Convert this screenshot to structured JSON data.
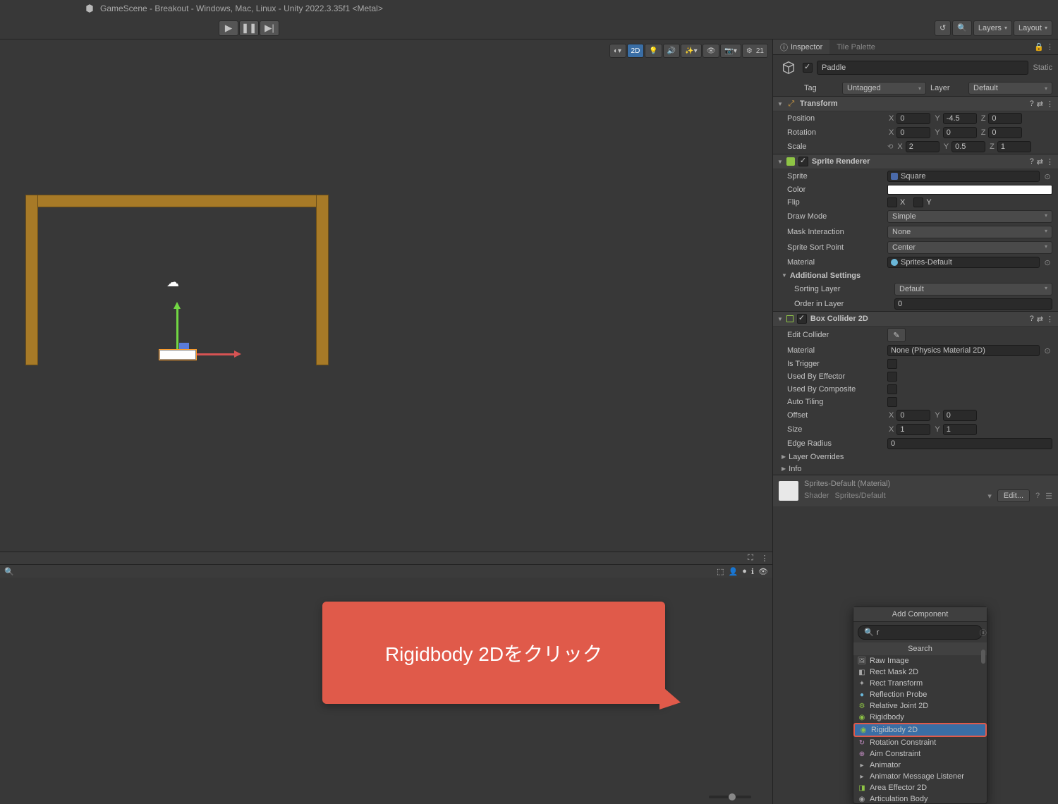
{
  "titlebar": {
    "text": "GameScene - Breakout - Windows, Mac, Linux - Unity 2022.3.35f1 <Metal>"
  },
  "toolbar": {
    "layers_label": "Layers",
    "layout_label": "Layout",
    "scene2d_label": "2D",
    "scene_count": "21"
  },
  "inspector": {
    "tab_inspector": "Inspector",
    "tab_tilepalette": "Tile Palette",
    "object_name": "Paddle",
    "static_label": "Static",
    "tag_label": "Tag",
    "tag_value": "Untagged",
    "layer_label": "Layer",
    "layer_value": "Default",
    "transform": {
      "title": "Transform",
      "position_label": "Position",
      "rotation_label": "Rotation",
      "scale_label": "Scale",
      "pos": {
        "x": "0",
        "y": "-4.5",
        "z": "0"
      },
      "rot": {
        "x": "0",
        "y": "0",
        "z": "0"
      },
      "scale": {
        "x": "2",
        "y": "0.5",
        "z": "1"
      }
    },
    "sprite_renderer": {
      "title": "Sprite Renderer",
      "sprite_label": "Sprite",
      "sprite_value": "Square",
      "color_label": "Color",
      "flip_label": "Flip",
      "flip_x": "X",
      "flip_y": "Y",
      "draw_mode_label": "Draw Mode",
      "draw_mode_value": "Simple",
      "mask_interaction_label": "Mask Interaction",
      "mask_interaction_value": "None",
      "sort_point_label": "Sprite Sort Point",
      "sort_point_value": "Center",
      "material_label": "Material",
      "material_value": "Sprites-Default",
      "additional_label": "Additional Settings",
      "sorting_layer_label": "Sorting Layer",
      "sorting_layer_value": "Default",
      "order_label": "Order in Layer",
      "order_value": "0"
    },
    "box_collider": {
      "title": "Box Collider 2D",
      "edit_collider_label": "Edit Collider",
      "material_label": "Material",
      "material_value": "None (Physics Material 2D)",
      "is_trigger_label": "Is Trigger",
      "used_by_effector_label": "Used By Effector",
      "used_by_composite_label": "Used By Composite",
      "auto_tiling_label": "Auto Tiling",
      "offset_label": "Offset",
      "offset_x": "0",
      "offset_y": "0",
      "size_label": "Size",
      "size_x": "1",
      "size_y": "1",
      "edge_radius_label": "Edge Radius",
      "edge_radius_value": "0",
      "layer_overrides_label": "Layer Overrides",
      "info_label": "Info"
    },
    "material": {
      "name": "Sprites-Default (Material)",
      "shader_label": "Shader",
      "shader_value": "Sprites/Default",
      "edit_label": "Edit..."
    }
  },
  "add_component": {
    "title": "Add Component",
    "search_value": "r",
    "search_header": "Search",
    "items": [
      {
        "label": "Raw Image",
        "icon": "🖼",
        "color": "#a8a8a8"
      },
      {
        "label": "Rect Mask 2D",
        "icon": "◧",
        "color": "#a8a8a8"
      },
      {
        "label": "Rect Transform",
        "icon": "✦",
        "color": "#a8a8a8"
      },
      {
        "label": "Reflection Probe",
        "icon": "●",
        "color": "#6ab7d8"
      },
      {
        "label": "Relative Joint 2D",
        "icon": "⚙",
        "color": "#8ec445"
      },
      {
        "label": "Rigidbody",
        "icon": "◉",
        "color": "#8ec445"
      },
      {
        "label": "Rigidbody 2D",
        "icon": "◉",
        "color": "#8ec445",
        "highlighted": true
      },
      {
        "label": "Rotation Constraint",
        "icon": "↻",
        "color": "#c48ec4"
      },
      {
        "label": "Aim Constraint",
        "icon": "⊕",
        "color": "#c48ec4"
      },
      {
        "label": "Animator",
        "icon": "▸",
        "color": "#a8a8a8"
      },
      {
        "label": "Animator Message Listener",
        "icon": "▸",
        "color": "#a8a8a8"
      },
      {
        "label": "Area Effector 2D",
        "icon": "◨",
        "color": "#8ec445"
      },
      {
        "label": "Articulation Body",
        "icon": "◉",
        "color": "#a8a8a8"
      }
    ]
  },
  "callout": {
    "text": "Rigidbody 2Dをクリック"
  }
}
